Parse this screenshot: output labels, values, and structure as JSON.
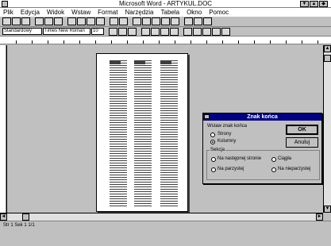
{
  "window": {
    "title": "Microsoft Word - ARTYKUL.DOC",
    "buttons": [
      "▼",
      "▲",
      "◆"
    ]
  },
  "menu": [
    "Plik",
    "Edycja",
    "Widok",
    "Wstaw",
    "Format",
    "Narzędzia",
    "Tabela",
    "Okno",
    "Pomoc"
  ],
  "toolbar2": {
    "style": "Standardowy",
    "font": "Times New Roman",
    "size": "10"
  },
  "dialog": {
    "title": "Znak końca",
    "insert_label": "Wstaw znak końca",
    "opt_strony": "Strony",
    "opt_kolumny": "Kolumny",
    "section_label": "Sekcja",
    "opt_nastepna": "Na następnej stronie",
    "opt_ciagla": "Ciągła",
    "opt_parzysta": "Na parzystej",
    "opt_nieparzysta": "Na nieparzystej",
    "ok_label": "OK",
    "cancel_label": "Anuluj"
  },
  "status": {
    "text": "Str 1  Sek 1  1/1"
  }
}
